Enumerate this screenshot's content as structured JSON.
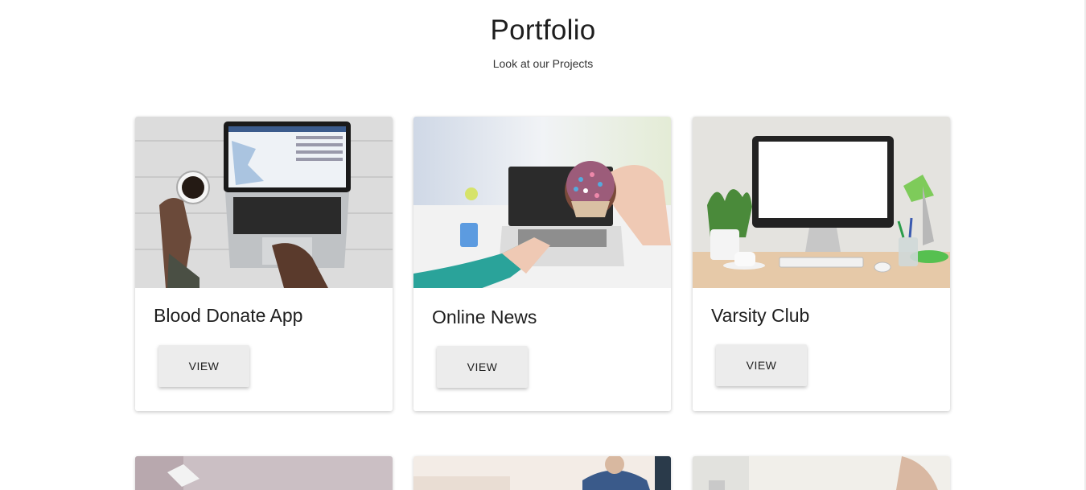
{
  "section": {
    "title": "Portfolio",
    "subtitle": "Look at our Projects"
  },
  "projects": [
    {
      "title": "Blood Donate App",
      "button_label": "VIEW",
      "image_icon": "laptop-map-photo"
    },
    {
      "title": "Online News",
      "button_label": "VIEW",
      "image_icon": "laptop-cupcake-photo"
    },
    {
      "title": "Varsity Club",
      "button_label": "VIEW",
      "image_icon": "desktop-workspace-photo"
    }
  ],
  "colors": {
    "background": "#ffffff",
    "card": "#ffffff",
    "button": "#ececec",
    "text": "#1e1e1e"
  }
}
